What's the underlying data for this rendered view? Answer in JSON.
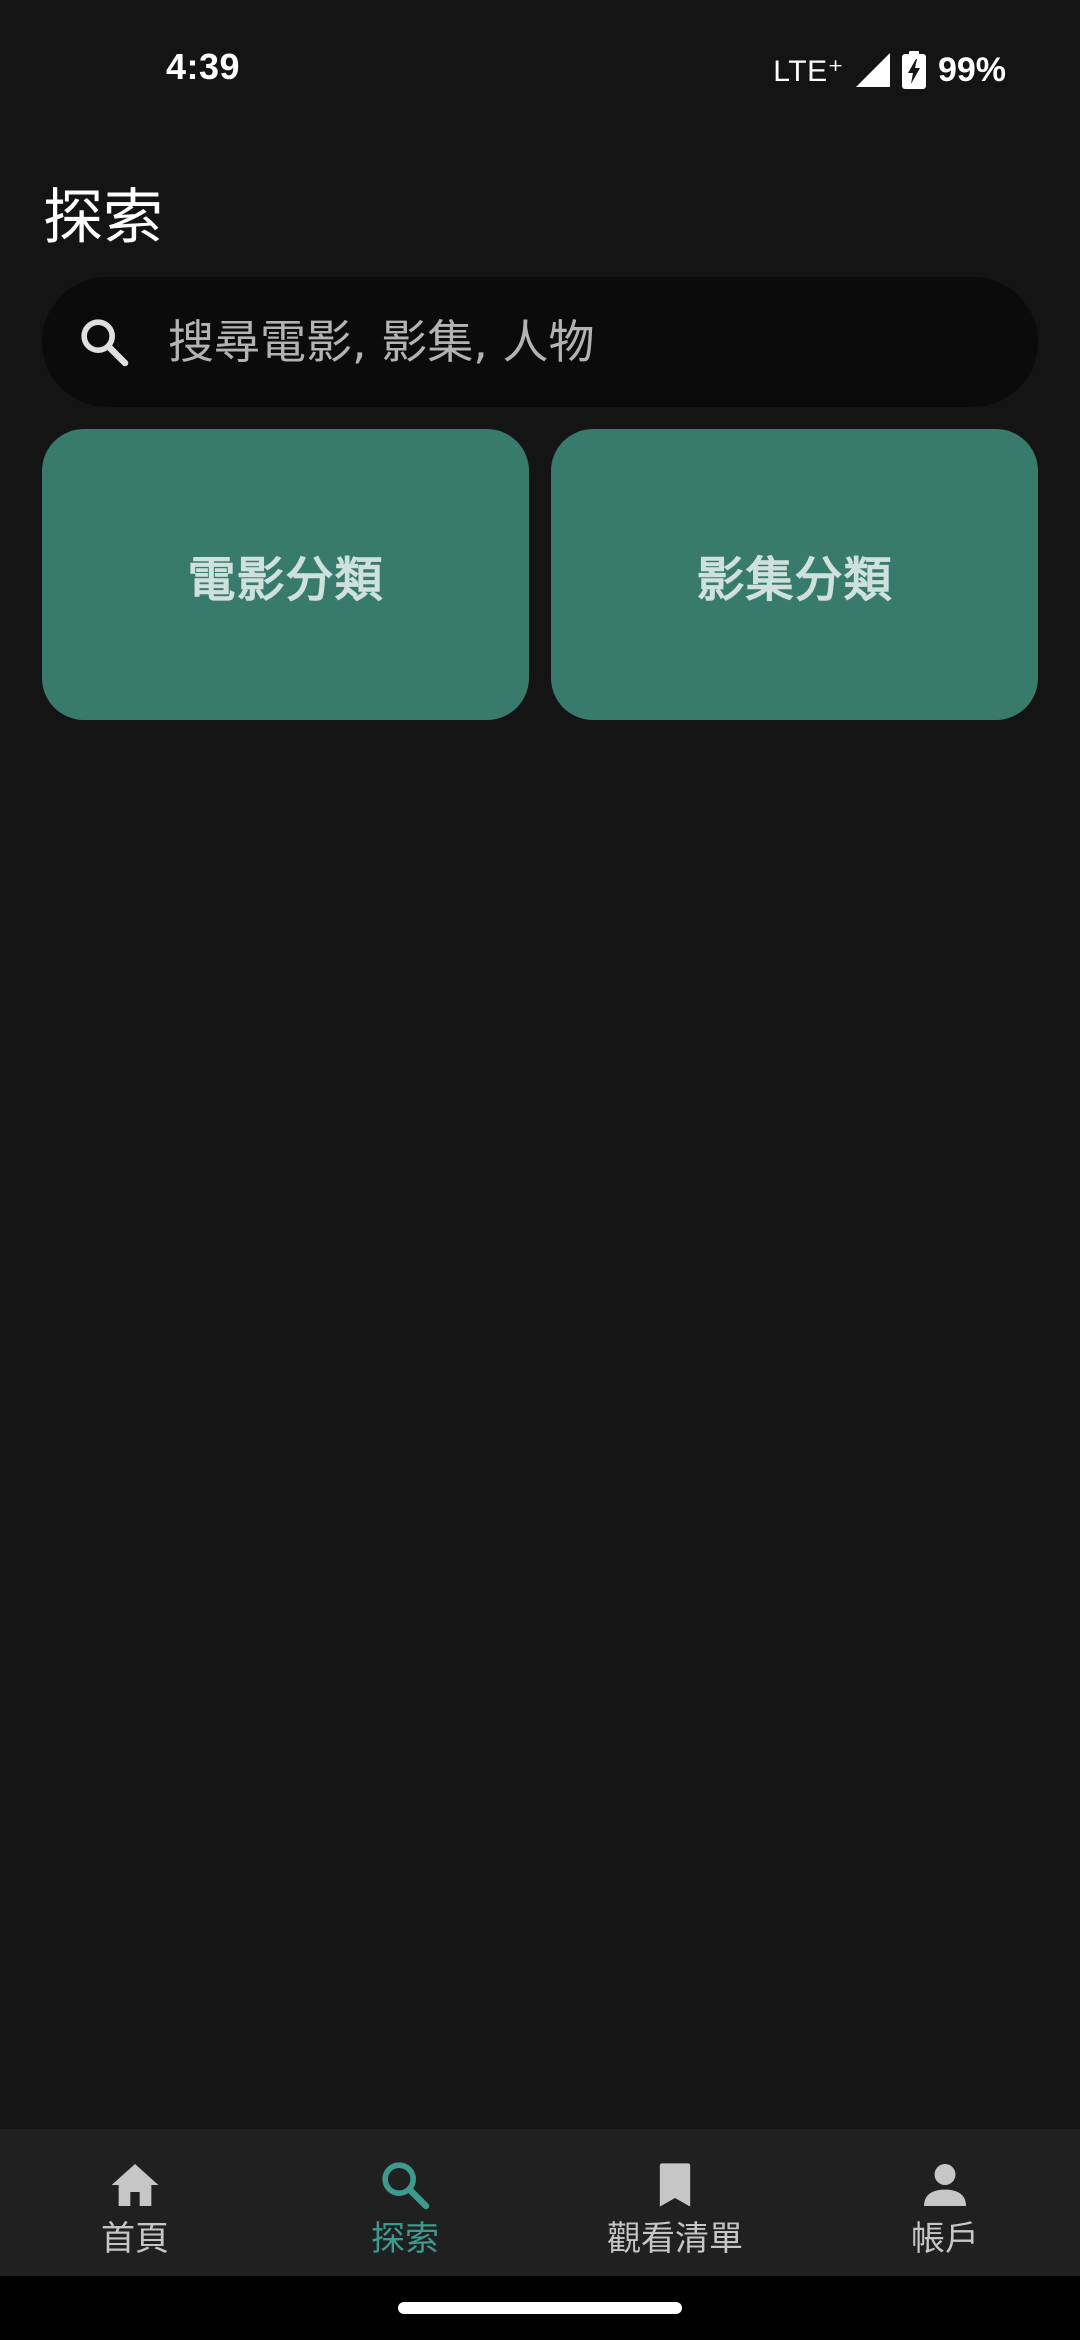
{
  "status_bar": {
    "time": "4:39",
    "network": "LTE⁺",
    "battery": "99%",
    "icons": [
      "cell-signal-icon",
      "battery-charging-icon"
    ]
  },
  "page": {
    "title": "探索"
  },
  "search": {
    "placeholder": "搜尋電影, 影集, 人物",
    "value": "",
    "icon": "search-icon"
  },
  "categories": [
    {
      "label": "電影分類"
    },
    {
      "label": "影集分類"
    }
  ],
  "bottom_nav": {
    "items": [
      {
        "label": "首頁",
        "icon": "home-icon",
        "active": false
      },
      {
        "label": "探索",
        "icon": "search-icon",
        "active": true
      },
      {
        "label": "觀看清單",
        "icon": "bookmark-icon",
        "active": false
      },
      {
        "label": "帳戶",
        "icon": "account-icon",
        "active": false
      }
    ]
  },
  "colors": {
    "background": "#141414",
    "search_background": "#0b0b0b",
    "card": "#387a6c",
    "card_text": "#cfe1dc",
    "nav_background": "#202020",
    "nav_active": "#3d9a8e",
    "nav_inactive": "#c6c6c6"
  }
}
